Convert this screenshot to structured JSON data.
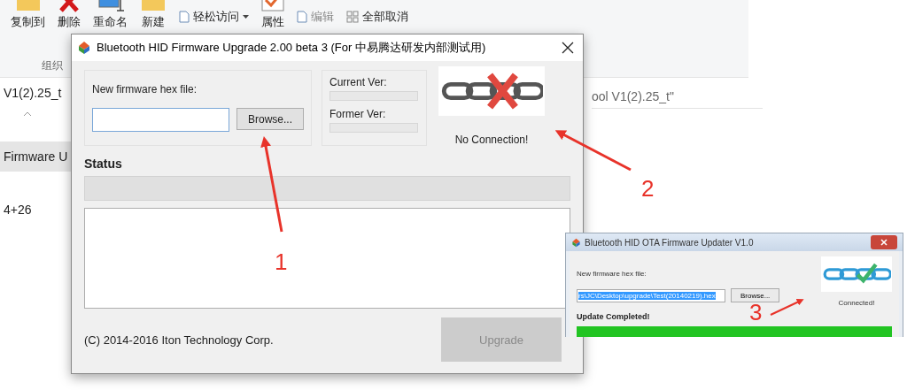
{
  "explorer": {
    "ribbon": [
      {
        "kind": "large",
        "label": "复制到"
      },
      {
        "kind": "large",
        "label": "删除"
      },
      {
        "kind": "large",
        "label": "重命名"
      },
      {
        "kind": "large",
        "label": "新建"
      },
      {
        "kind": "small",
        "label": "轻松访问",
        "dropdown": true,
        "disabled": false
      },
      {
        "kind": "large",
        "label": "属性"
      },
      {
        "kind": "small",
        "label": "编辑",
        "dropdown": false,
        "disabled": true
      },
      {
        "kind": "small",
        "label": "全部取消",
        "dropdown": false,
        "disabled": false
      }
    ],
    "group_label": "组织",
    "rows": [
      {
        "text": "V1(2).25_t",
        "selected": false
      },
      {
        "text": "Firmware U",
        "selected": true
      },
      {
        "text": "4+26",
        "selected": false
      }
    ],
    "right_row": "ool V1(2).25_t\""
  },
  "dialog": {
    "title": "Bluetooth HID Firmware Upgrade 2.00 beta 3 (For 中易腾达研发内部测试用)",
    "file_label": "New firmware hex file:",
    "browse": "Browse...",
    "current_ver_label": "Current Ver:",
    "former_ver_label": "Former Ver:",
    "connected": false,
    "connection_text": "No Connection!",
    "status_label": "Status",
    "progress": {
      "level": 0
    },
    "copyright": "(C) 2014-2016 Iton Technology Corp.",
    "upgrade": {
      "label": "Upgrade",
      "disabled": true
    }
  },
  "inset": {
    "title": "Bluetooth HID OTA Firmware Updater V1.0",
    "file_label": "New firmware hex file:",
    "file_value": "rs\\JC\\Desktop\\upgrade\\Test(20140219).hex",
    "browse": "Browse...",
    "connected": true,
    "connection_text": "Connected!",
    "status_label": "Update Completed!",
    "progress": {
      "level": 1
    }
  },
  "annotations": [
    {
      "number": "1"
    },
    {
      "number": "2"
    },
    {
      "number": "3"
    }
  ]
}
